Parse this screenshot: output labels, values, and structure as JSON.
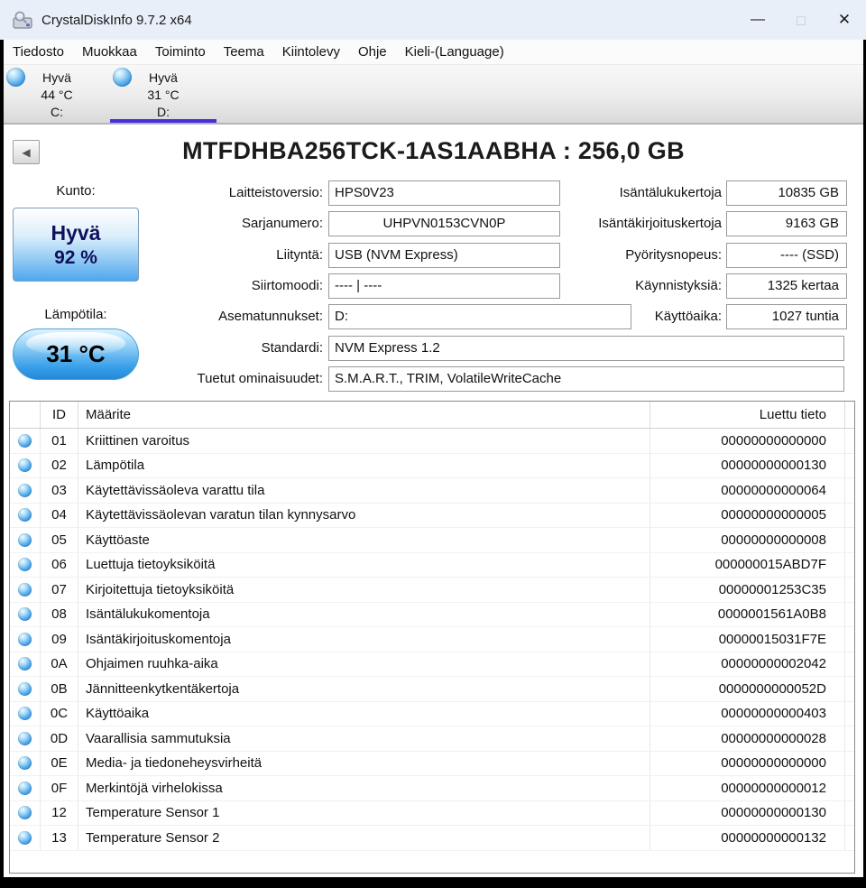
{
  "window": {
    "title": "CrystalDiskInfo 9.7.2 x64",
    "minimize_glyph": "—",
    "maximize_glyph": "◻",
    "close_glyph": "✕"
  },
  "menu": [
    "Tiedosto",
    "Muokkaa",
    "Toiminto",
    "Teema",
    "Kiintolevy",
    "Ohje",
    "Kieli-(Language)"
  ],
  "drive_tabs": [
    {
      "status": "Hyvä",
      "temperature": "44 °C",
      "letter": "C:",
      "selected": false
    },
    {
      "status": "Hyvä",
      "temperature": "31 °C",
      "letter": "D:",
      "selected": true
    }
  ],
  "device": {
    "title": "MTFDHBA256TCK-1AS1AABHA : 256,0 GB"
  },
  "health": {
    "label": "Kunto:",
    "status": "Hyvä",
    "percent": "92 %"
  },
  "temperature": {
    "label": "Lämpötila:",
    "value": "31 °C"
  },
  "fields_left": [
    {
      "label": "Laitteistoversio:",
      "value": "HPS0V23"
    },
    {
      "label": "Sarjanumero:",
      "value": "UHPVN0153CVN0P"
    },
    {
      "label": "Liityntä:",
      "value": "USB (NVM Express)"
    },
    {
      "label": "Siirtomoodi:",
      "value": "---- | ----"
    },
    {
      "label": "Asematunnukset:",
      "value": "D:"
    },
    {
      "label": "Standardi:",
      "value": "NVM Express 1.2"
    },
    {
      "label": "Tuetut ominaisuudet:",
      "value": "S.M.A.R.T., TRIM, VolatileWriteCache"
    }
  ],
  "fields_right": [
    {
      "label": "Isäntälukukertoja",
      "value": "10835 GB"
    },
    {
      "label": "Isäntäkirjoituskertoja",
      "value": "9163 GB"
    },
    {
      "label": "Pyöritysnopeus:",
      "value": "---- (SSD)"
    },
    {
      "label": "Käynnistyksiä:",
      "value": "1325 kertaa"
    },
    {
      "label": "Käyttöaika:",
      "value": "1027 tuntia"
    }
  ],
  "smart_table": {
    "headers": {
      "id": "ID",
      "attribute": "Määrite",
      "value": "Luettu tieto"
    },
    "rows": [
      {
        "id": "01",
        "attribute": "Kriittinen varoitus",
        "value": "00000000000000"
      },
      {
        "id": "02",
        "attribute": "Lämpötila",
        "value": "00000000000130"
      },
      {
        "id": "03",
        "attribute": "Käytettävissäoleva varattu tila",
        "value": "00000000000064"
      },
      {
        "id": "04",
        "attribute": "Käytettävissäolevan varatun tilan kynnysarvo",
        "value": "00000000000005"
      },
      {
        "id": "05",
        "attribute": "Käyttöaste",
        "value": "00000000000008"
      },
      {
        "id": "06",
        "attribute": "Luettuja tietoyksiköitä",
        "value": "000000015ABD7F"
      },
      {
        "id": "07",
        "attribute": "Kirjoitettuja tietoyksiköitä",
        "value": "00000001253C35"
      },
      {
        "id": "08",
        "attribute": "Isäntälukukomentoja",
        "value": "0000001561A0B8"
      },
      {
        "id": "09",
        "attribute": "Isäntäkirjoituskomentoja",
        "value": "00000015031F7E"
      },
      {
        "id": "0A",
        "attribute": "Ohjaimen ruuhka-aika",
        "value": "00000000002042"
      },
      {
        "id": "0B",
        "attribute": "Jännitteenkytkentäkertoja",
        "value": "0000000000052D"
      },
      {
        "id": "0C",
        "attribute": "Käyttöaika",
        "value": "00000000000403"
      },
      {
        "id": "0D",
        "attribute": "Vaarallisia sammutuksia",
        "value": "00000000000028"
      },
      {
        "id": "0E",
        "attribute": "Media- ja tiedoneheysvirheitä",
        "value": "00000000000000"
      },
      {
        "id": "0F",
        "attribute": "Merkintöjä virhelokissa",
        "value": "00000000000012"
      },
      {
        "id": "12",
        "attribute": "Temperature Sensor 1",
        "value": "00000000000130"
      },
      {
        "id": "13",
        "attribute": "Temperature Sensor 2",
        "value": "00000000000132"
      }
    ]
  },
  "colors": {
    "titlebar_bg": "#e9eff8",
    "selected_tab_underline": "#4632d8",
    "health_button_blue": "#4ea7ef",
    "status_orb_blue": "#2e86d4"
  }
}
